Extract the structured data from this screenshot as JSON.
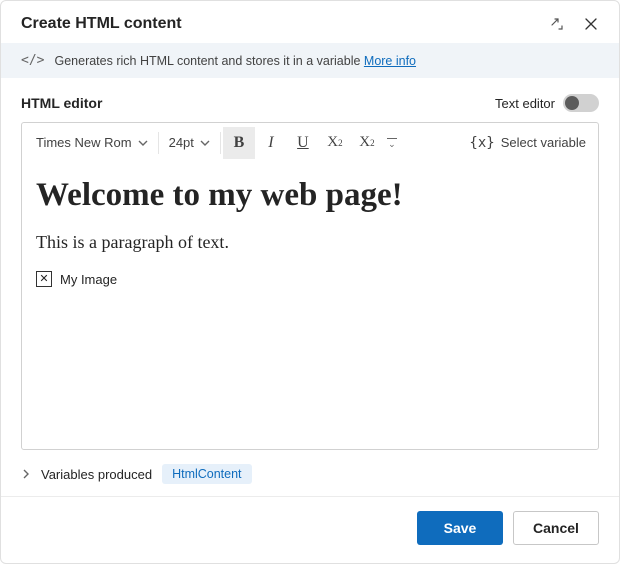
{
  "dialog": {
    "title": "Create HTML content"
  },
  "info": {
    "description": "Generates rich HTML content and stores it in a variable",
    "link_label": "More info"
  },
  "editor": {
    "label": "HTML editor",
    "text_editor_label": "Text editor",
    "toolbar": {
      "font_family": "Times New Rom",
      "font_size": "24pt",
      "bold_glyph": "B",
      "italic_glyph": "I",
      "underline_glyph": "U",
      "subscript_label": "X",
      "superscript_label": "X",
      "insert_variable_label": "Select variable",
      "insert_variable_glyph": "{x}"
    },
    "content": {
      "heading": "Welcome to my web page!",
      "paragraph": "This is a paragraph of text.",
      "image_alt": "My Image"
    }
  },
  "variables": {
    "label": "Variables produced",
    "items": [
      "HtmlContent"
    ]
  },
  "footer": {
    "save_label": "Save",
    "cancel_label": "Cancel"
  }
}
